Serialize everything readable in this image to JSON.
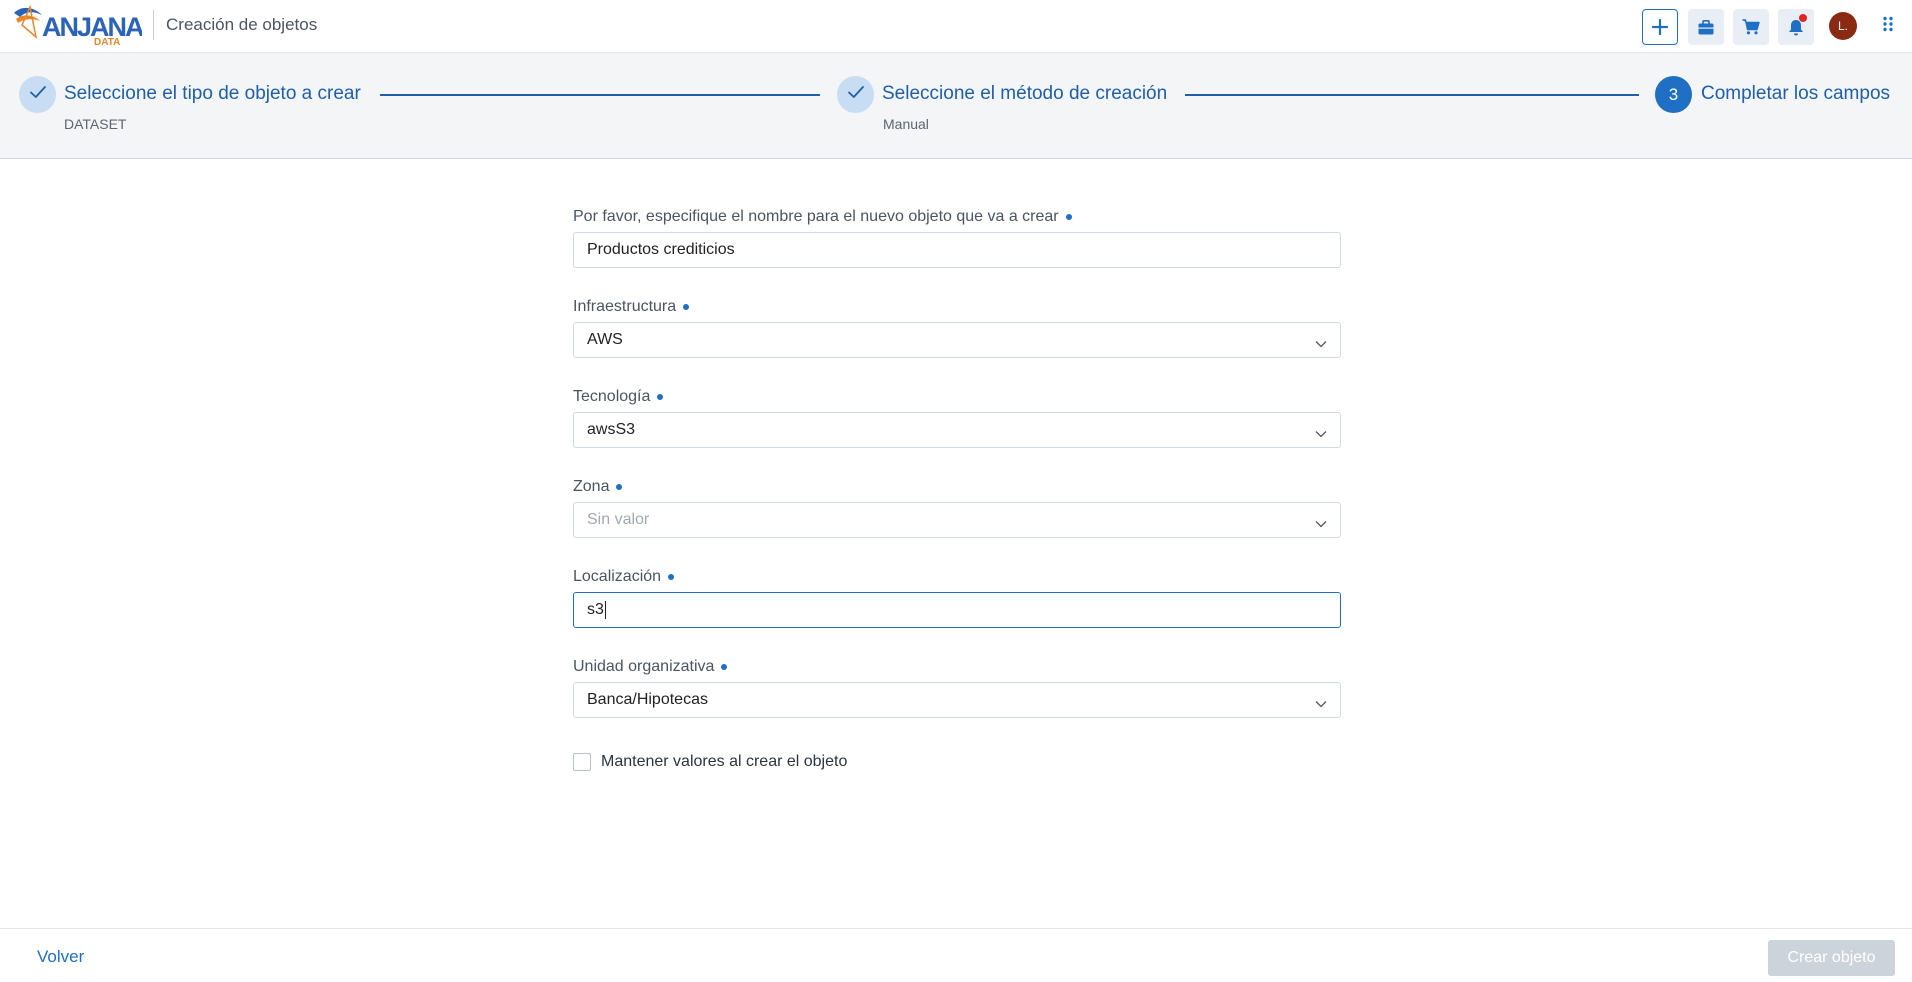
{
  "header": {
    "logo_text": "ANJANA",
    "logo_subtext": "DATA",
    "page_title": "Creación de objetos",
    "avatar_initial": "L.",
    "icons": [
      "plus-icon",
      "briefcase-icon",
      "cart-icon",
      "bell-icon",
      "apps-grid-icon"
    ]
  },
  "stepper": {
    "steps": [
      {
        "title": "Seleccione el tipo de objeto a crear",
        "subtitle": "DATASET",
        "status": "done"
      },
      {
        "title": "Seleccione el método de creación",
        "subtitle": "Manual",
        "status": "done"
      },
      {
        "number": "3",
        "title": "Completar los campos",
        "subtitle": "",
        "status": "active"
      }
    ]
  },
  "form": {
    "name": {
      "label": "Por favor, especifique el nombre para el nuevo objeto que va a crear",
      "value": "Productos crediticios"
    },
    "infraestructura": {
      "label": "Infraestructura",
      "value": "AWS"
    },
    "tecnologia": {
      "label": "Tecnología",
      "value": "awsS3"
    },
    "zona": {
      "label": "Zona",
      "placeholder": "Sin valor"
    },
    "localizacion": {
      "label": "Localización",
      "value": "s3"
    },
    "unidad": {
      "label": "Unidad organizativa",
      "value": "Banca/Hipotecas"
    },
    "keep_values": {
      "label": "Mantener valores al crear el objeto",
      "checked": false
    }
  },
  "footer": {
    "back_label": "Volver",
    "create_label": "Crear objeto"
  },
  "colors": {
    "accent": "#1f6fc5",
    "step_done": "#c8dcf3",
    "disabled_button": "#cdd3da",
    "notification": "#e02424",
    "avatar": "#8a2a12"
  }
}
